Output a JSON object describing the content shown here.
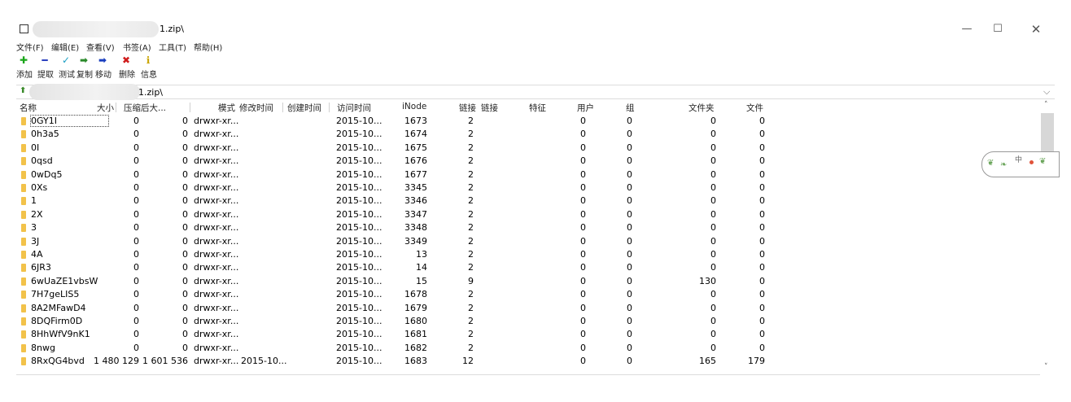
{
  "window": {
    "title_suffix": "1.zip\\",
    "controls": {
      "minimize": "—",
      "maximize": "☐",
      "close": "✕"
    }
  },
  "menu": [
    "文件(F)",
    "编辑(E)",
    "查看(V)",
    "书签(A)",
    "工具(T)",
    "帮助(H)"
  ],
  "toolbar": [
    {
      "name": "add",
      "label": "添加",
      "icon": "plus-icon",
      "glyph": "✚",
      "color": "#1aa61a"
    },
    {
      "name": "extract",
      "label": "提取",
      "icon": "minus-icon",
      "glyph": "━",
      "color": "#2a3fbf"
    },
    {
      "name": "test",
      "label": "测试",
      "icon": "check-icon",
      "glyph": "✓",
      "color": "#1a9ec4"
    },
    {
      "name": "copy",
      "label": "复制",
      "icon": "copy-arrow-icon",
      "glyph": "➡",
      "color": "#2a8a2a"
    },
    {
      "name": "move",
      "label": "移动",
      "icon": "move-arrow-icon",
      "glyph": "➡",
      "color": "#1a3fbf"
    },
    {
      "name": "delete",
      "label": "删除",
      "icon": "delete-x-icon",
      "glyph": "✖",
      "color": "#d01c1c"
    },
    {
      "name": "info",
      "label": "信息",
      "icon": "info-icon",
      "glyph": "ℹ",
      "color": "#c9a400"
    }
  ],
  "address": {
    "up_glyph": "⬆",
    "path_suffix": "1.zip\\",
    "dropdown": "⌵"
  },
  "columns": [
    "名称",
    "大小",
    "压缩后大...",
    "模式",
    "修改时间",
    "创建时间",
    "访问时间",
    "iNode",
    "链接",
    "链接",
    "特征",
    "用户",
    "组",
    "文件夹",
    "文件"
  ],
  "rows": [
    {
      "name": "0GY1I",
      "size": "0",
      "packed": "0",
      "mode": "drwxr-xr...",
      "mtime": "",
      "atime": "2015-10...",
      "inode": "1673",
      "links": "2",
      "user": "0",
      "group": "0",
      "folders": "0",
      "files": "0"
    },
    {
      "name": "0h3a5",
      "size": "0",
      "packed": "0",
      "mode": "drwxr-xr...",
      "mtime": "",
      "atime": "2015-10...",
      "inode": "1674",
      "links": "2",
      "user": "0",
      "group": "0",
      "folders": "0",
      "files": "0"
    },
    {
      "name": "0I",
      "size": "0",
      "packed": "0",
      "mode": "drwxr-xr...",
      "mtime": "",
      "atime": "2015-10...",
      "inode": "1675",
      "links": "2",
      "user": "0",
      "group": "0",
      "folders": "0",
      "files": "0"
    },
    {
      "name": "0qsd",
      "size": "0",
      "packed": "0",
      "mode": "drwxr-xr...",
      "mtime": "",
      "atime": "2015-10...",
      "inode": "1676",
      "links": "2",
      "user": "0",
      "group": "0",
      "folders": "0",
      "files": "0"
    },
    {
      "name": "0wDq5",
      "size": "0",
      "packed": "0",
      "mode": "drwxr-xr...",
      "mtime": "",
      "atime": "2015-10...",
      "inode": "1677",
      "links": "2",
      "user": "0",
      "group": "0",
      "folders": "0",
      "files": "0"
    },
    {
      "name": "0Xs",
      "size": "0",
      "packed": "0",
      "mode": "drwxr-xr...",
      "mtime": "",
      "atime": "2015-10...",
      "inode": "3345",
      "links": "2",
      "user": "0",
      "group": "0",
      "folders": "0",
      "files": "0"
    },
    {
      "name": "1",
      "size": "0",
      "packed": "0",
      "mode": "drwxr-xr...",
      "mtime": "",
      "atime": "2015-10...",
      "inode": "3346",
      "links": "2",
      "user": "0",
      "group": "0",
      "folders": "0",
      "files": "0"
    },
    {
      "name": "2X",
      "size": "0",
      "packed": "0",
      "mode": "drwxr-xr...",
      "mtime": "",
      "atime": "2015-10...",
      "inode": "3347",
      "links": "2",
      "user": "0",
      "group": "0",
      "folders": "0",
      "files": "0"
    },
    {
      "name": "3",
      "size": "0",
      "packed": "0",
      "mode": "drwxr-xr...",
      "mtime": "",
      "atime": "2015-10...",
      "inode": "3348",
      "links": "2",
      "user": "0",
      "group": "0",
      "folders": "0",
      "files": "0"
    },
    {
      "name": "3J",
      "size": "0",
      "packed": "0",
      "mode": "drwxr-xr...",
      "mtime": "",
      "atime": "2015-10...",
      "inode": "3349",
      "links": "2",
      "user": "0",
      "group": "0",
      "folders": "0",
      "files": "0"
    },
    {
      "name": "4A",
      "size": "0",
      "packed": "0",
      "mode": "drwxr-xr...",
      "mtime": "",
      "atime": "2015-10...",
      "inode": "13",
      "links": "2",
      "user": "0",
      "group": "0",
      "folders": "0",
      "files": "0"
    },
    {
      "name": "6JR3",
      "size": "0",
      "packed": "0",
      "mode": "drwxr-xr...",
      "mtime": "",
      "atime": "2015-10...",
      "inode": "14",
      "links": "2",
      "user": "0",
      "group": "0",
      "folders": "0",
      "files": "0"
    },
    {
      "name": "6wUaZE1vbsW",
      "size": "0",
      "packed": "0",
      "mode": "drwxr-xr...",
      "mtime": "",
      "atime": "2015-10...",
      "inode": "15",
      "links": "9",
      "user": "0",
      "group": "0",
      "folders": "130",
      "files": "0"
    },
    {
      "name": "7H7geLIS5",
      "size": "0",
      "packed": "0",
      "mode": "drwxr-xr...",
      "mtime": "",
      "atime": "2015-10...",
      "inode": "1678",
      "links": "2",
      "user": "0",
      "group": "0",
      "folders": "0",
      "files": "0"
    },
    {
      "name": "8A2MFawD4",
      "size": "0",
      "packed": "0",
      "mode": "drwxr-xr...",
      "mtime": "",
      "atime": "2015-10...",
      "inode": "1679",
      "links": "2",
      "user": "0",
      "group": "0",
      "folders": "0",
      "files": "0"
    },
    {
      "name": "8DQFirm0D",
      "size": "0",
      "packed": "0",
      "mode": "drwxr-xr...",
      "mtime": "",
      "atime": "2015-10...",
      "inode": "1680",
      "links": "2",
      "user": "0",
      "group": "0",
      "folders": "0",
      "files": "0"
    },
    {
      "name": "8HhWfV9nK1",
      "size": "0",
      "packed": "0",
      "mode": "drwxr-xr...",
      "mtime": "",
      "atime": "2015-10...",
      "inode": "1681",
      "links": "2",
      "user": "0",
      "group": "0",
      "folders": "0",
      "files": "0"
    },
    {
      "name": "8nwg",
      "size": "0",
      "packed": "0",
      "mode": "drwxr-xr...",
      "mtime": "",
      "atime": "2015-10...",
      "inode": "1682",
      "links": "2",
      "user": "0",
      "group": "0",
      "folders": "0",
      "files": "0"
    },
    {
      "name": "8RxQG4bvd",
      "size": "1 480 129",
      "packed": "1 601 536",
      "mode": "drwxr-xr...",
      "mtime": "2015-10...",
      "atime": "2015-10...",
      "inode": "1683",
      "links": "12",
      "user": "0",
      "group": "0",
      "folders": "165",
      "files": "179"
    }
  ],
  "scrollbar": {
    "up": "˄",
    "down": "˅"
  },
  "widget": {
    "label": "中"
  }
}
